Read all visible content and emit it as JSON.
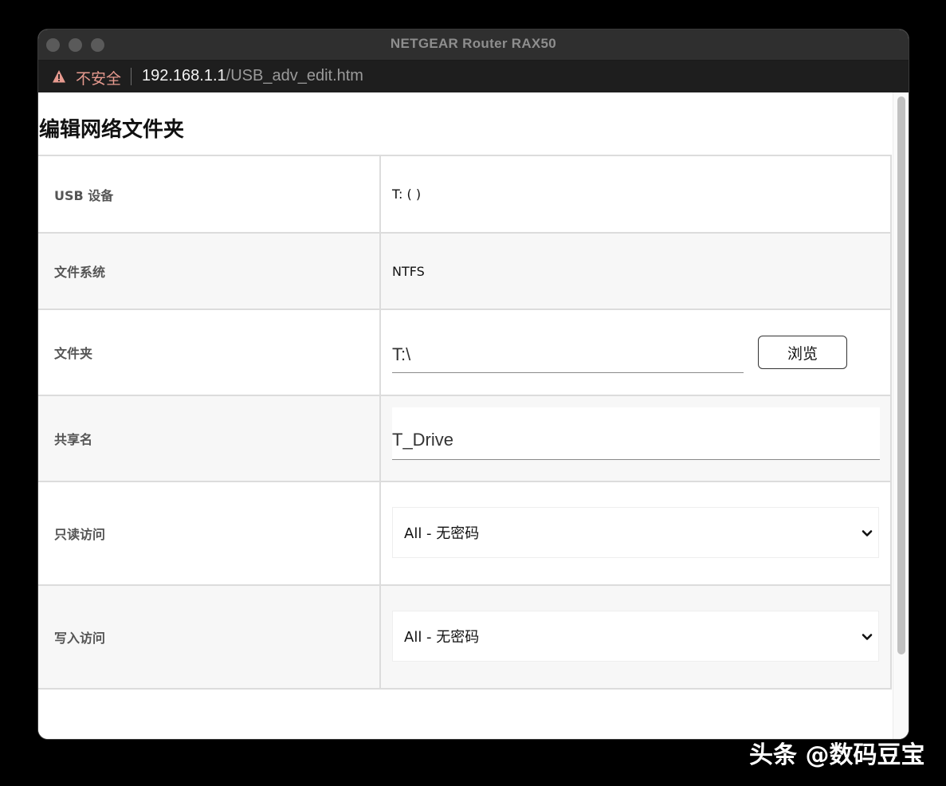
{
  "window": {
    "title": "NETGEAR Router RAX50"
  },
  "address_bar": {
    "security_label": "不安全",
    "url_host": "192.168.1.1",
    "url_path": "/USB_adv_edit.htm"
  },
  "page": {
    "title": "编辑网络文件夹"
  },
  "form": {
    "usb_device": {
      "label": "USB 设备",
      "value": "T: ( )"
    },
    "file_system": {
      "label": "文件系统",
      "value": "NTFS"
    },
    "folder": {
      "label": "文件夹",
      "value": "T:\\",
      "browse_label": "浏览"
    },
    "share_name": {
      "label": "共享名",
      "value": "T_Drive"
    },
    "read_access": {
      "label": "只读访问",
      "selected": "All - 无密码"
    },
    "write_access": {
      "label": "写入访问",
      "selected": "All - 无密码"
    }
  },
  "watermark": {
    "text": "头条 @数码豆宝"
  },
  "colors": {
    "warning": "#e79a8f",
    "row_alt": "#f7f7f7",
    "border": "#dcdcdc"
  }
}
